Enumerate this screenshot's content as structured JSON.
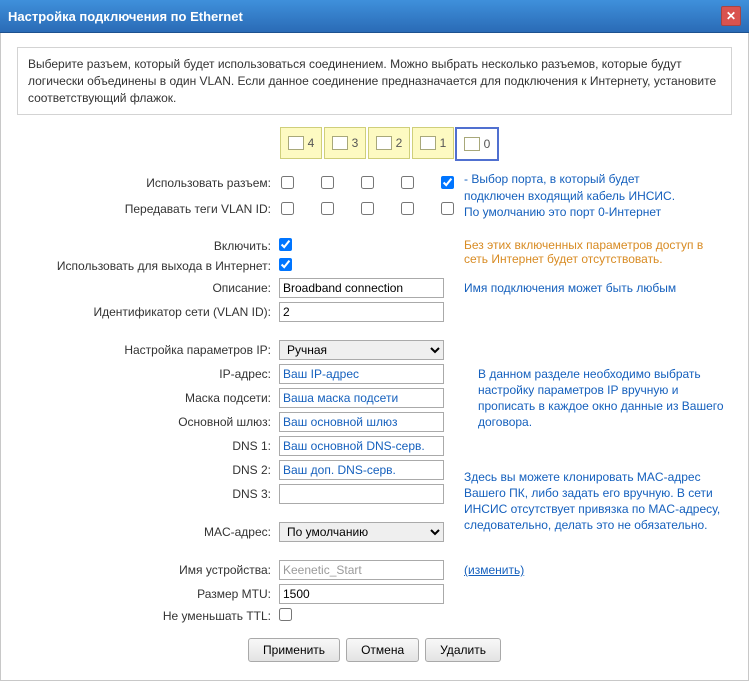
{
  "title": "Настройка подключения по Ethernet",
  "intro": "Выберите разъем, который будет использоваться соединением. Можно выбрать несколько разъемов, которые будут логически объединены в один VLAN. Если данное соединение предназначается для подключения к Интернету, установите соответствующий флажок.",
  "ports": [
    "4",
    "3",
    "2",
    "1",
    "0"
  ],
  "labels": {
    "use_port": "Использовать разъем:",
    "vlan_tags": "Передавать теги VLAN ID:",
    "enable": "Включить:",
    "use_internet": "Использовать для выхода в Интернет:",
    "description": "Описание:",
    "vlan_id": "Идентификатор сети (VLAN ID):",
    "ip_setup": "Настройка параметров IP:",
    "ip_addr": "IP-адрес:",
    "netmask": "Маска подсети:",
    "gateway": "Основной шлюз:",
    "dns1": "DNS 1:",
    "dns2": "DNS 2:",
    "dns3": "DNS 3:",
    "mac": "MAC-адрес:",
    "device_name": "Имя устройства:",
    "mtu": "Размер MTU:",
    "no_ttl": "Не уменьшать TTL:"
  },
  "notes": {
    "port_choice": "- Выбор порта, в который будет подключен входящий кабель ИНСИС. По умолчанию это порт 0-Интернет",
    "enable_needed": "Без этих включенных параметров доступ в сеть Интернет будет отсутствовать.",
    "desc_any": "Имя подключения может быть любым",
    "ip_section": "В данном разделе необходимо выбрать настройку параметров IP вручную и прописать в каждое окно данные из Вашего договора.",
    "mac_section": "Здесь вы можете клонировать MAC-адрес Вашего ПК, либо задать его вручную. В сети ИНСИС отсутствует привязка по MAC-адресу, следовательно, делать это не обязательно."
  },
  "values": {
    "description": "Broadband connection",
    "vlan_id": "2",
    "ip_mode": "Ручная",
    "ip_addr_ph": "Ваш IP-адрес",
    "netmask_ph": "Ваша маска подсети",
    "gateway_ph": "Ваш основной шлюз",
    "dns1_ph": "Ваш основной DNS-серв.",
    "dns2_ph": "Ваш доп. DNS-серв.",
    "dns3": "",
    "mac_mode": "По умолчанию",
    "device_name": "Keenetic_Start",
    "mtu": "1500",
    "change_link": "(изменить)"
  },
  "buttons": {
    "apply": "Применить",
    "cancel": "Отмена",
    "delete": "Удалить"
  }
}
